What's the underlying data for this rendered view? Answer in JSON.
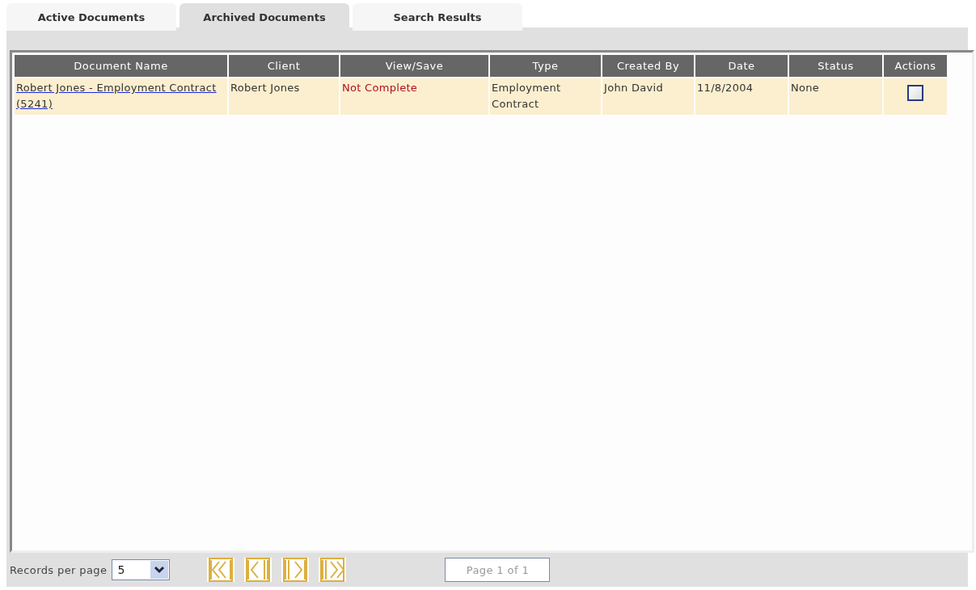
{
  "tabs": [
    {
      "label": "Active Documents",
      "selected": false
    },
    {
      "label": "Archived Documents",
      "selected": true
    },
    {
      "label": "Search Results",
      "selected": false
    }
  ],
  "table": {
    "columns": [
      "Document Name",
      "Client",
      "View/Save",
      "Type",
      "Created By",
      "Date",
      "Status",
      "Actions"
    ],
    "rows": [
      {
        "document_name": "Robert Jones - Employment Contract (5241)",
        "client": "Robert Jones",
        "view_save": "Not Complete",
        "type": "Employment Contract",
        "created_by": "John David",
        "date": "11/8/2004",
        "status": "None",
        "checked": false
      }
    ]
  },
  "footer": {
    "records_label": "Records per page",
    "records_per_page": "5",
    "page_info": "Page 1 of 1"
  }
}
